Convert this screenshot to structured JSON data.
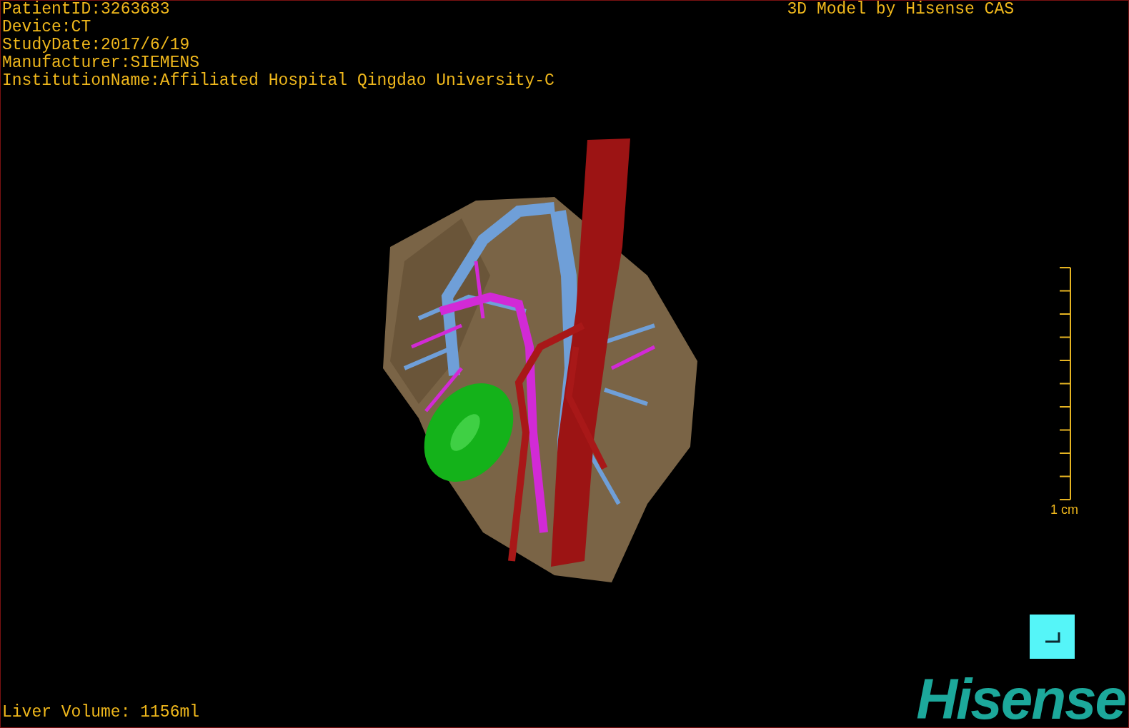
{
  "info_lines": [
    "PatientID:3263683",
    "Device:CT",
    "StudyDate:2017/6/19",
    "Manufacturer:SIEMENS",
    "InstitutionName:Affiliated Hospital Qingdao University-C"
  ],
  "title": "3D Model by Hisense CAS",
  "scale_bar": {
    "label": "1 cm"
  },
  "liver_volume": "Liver Volume: 1156ml",
  "logo": "Hisense"
}
